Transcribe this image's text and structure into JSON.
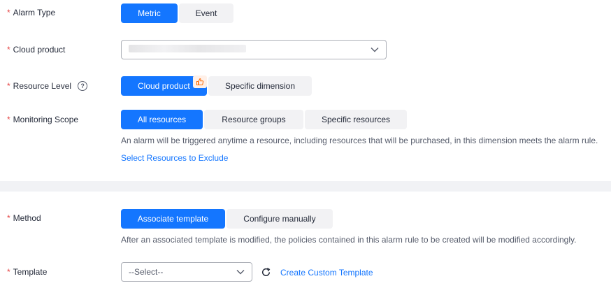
{
  "alarm_type": {
    "label": "Alarm Type",
    "options": [
      "Metric",
      "Event"
    ],
    "selected": "Metric"
  },
  "cloud_product": {
    "label": "Cloud product"
  },
  "resource_level": {
    "label": "Resource Level",
    "help": "?",
    "options": [
      "Cloud product",
      "Specific dimension"
    ],
    "selected": "Cloud product"
  },
  "monitoring_scope": {
    "label": "Monitoring Scope",
    "options": [
      "All resources",
      "Resource groups",
      "Specific resources"
    ],
    "selected": "All resources",
    "hint": "An alarm will be triggered anytime a resource, including resources that will be purchased, in this dimension meets the alarm rule.",
    "exclude_link": "Select Resources to Exclude"
  },
  "method": {
    "label": "Method",
    "options": [
      "Associate template",
      "Configure manually"
    ],
    "selected": "Associate template",
    "hint": "After an associated template is modified, the policies contained in this alarm rule to be created will be modified accordingly."
  },
  "template": {
    "label": "Template",
    "placeholder": "--Select--",
    "create_link": "Create Custom Template"
  },
  "required_mark": "*",
  "colors": {
    "primary": "#1476ff",
    "required": "#e54545",
    "badge": "#ff6a00"
  }
}
